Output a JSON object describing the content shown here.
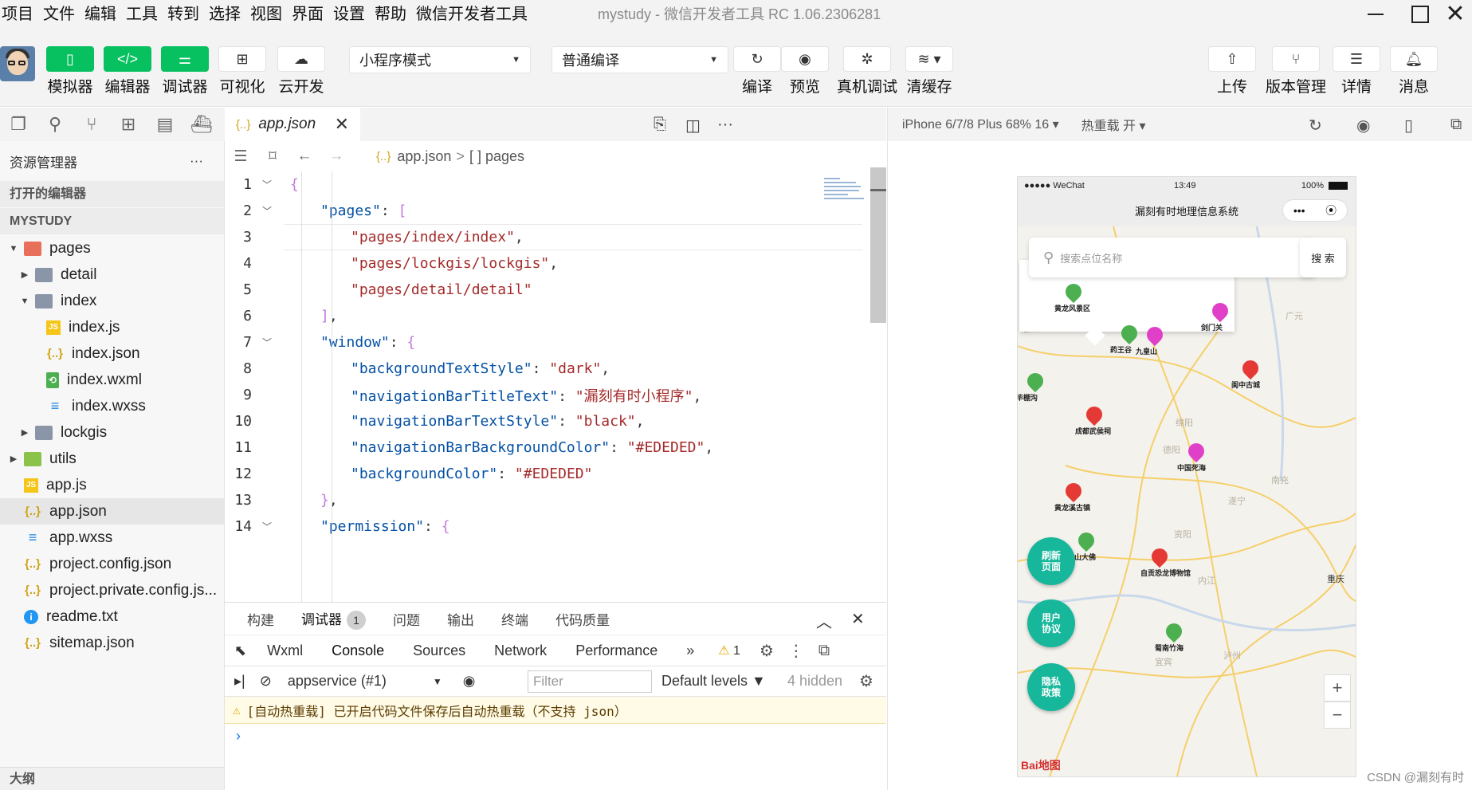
{
  "menu": [
    "项目",
    "文件",
    "编辑",
    "工具",
    "转到",
    "选择",
    "视图",
    "界面",
    "设置",
    "帮助",
    "微信开发者工具"
  ],
  "window_title": "mystudy - 微信开发者工具 RC 1.06.2306281",
  "toolbar": {
    "simulator": "模拟器",
    "editor": "编辑器",
    "debugger": "调试器",
    "visual": "可视化",
    "cloud": "云开发",
    "mode": "小程序模式",
    "compile_mode": "普通编译",
    "compile": "编译",
    "preview": "预览",
    "remote_debug": "真机调试",
    "clear_cache": "清缓存",
    "upload": "上传",
    "version": "版本管理",
    "details": "详情",
    "messages": "消息"
  },
  "explorer": {
    "title": "资源管理器",
    "more": "···",
    "open_editors": "打开的编辑器",
    "project": "MYSTUDY",
    "tree": [
      {
        "label": "pages",
        "depth": 0,
        "type": "folder-pages",
        "twisty": "▼"
      },
      {
        "label": "detail",
        "depth": 1,
        "type": "folder",
        "twisty": "▶"
      },
      {
        "label": "index",
        "depth": 1,
        "type": "folder",
        "twisty": "▼"
      },
      {
        "label": "index.js",
        "depth": 2,
        "type": "js",
        "twisty": ""
      },
      {
        "label": "index.json",
        "depth": 2,
        "type": "json",
        "twisty": ""
      },
      {
        "label": "index.wxml",
        "depth": 2,
        "type": "wxml",
        "twisty": ""
      },
      {
        "label": "index.wxss",
        "depth": 2,
        "type": "wxss",
        "twisty": ""
      },
      {
        "label": "lockgis",
        "depth": 1,
        "type": "folder",
        "twisty": "▶"
      },
      {
        "label": "utils",
        "depth": 0,
        "type": "folder-utils",
        "twisty": "▶"
      },
      {
        "label": "app.js",
        "depth": 0,
        "type": "js",
        "twisty": ""
      },
      {
        "label": "app.json",
        "depth": 0,
        "type": "json",
        "twisty": "",
        "selected": true
      },
      {
        "label": "app.wxss",
        "depth": 0,
        "type": "wxss",
        "twisty": ""
      },
      {
        "label": "project.config.json",
        "depth": 0,
        "type": "json",
        "twisty": ""
      },
      {
        "label": "project.private.config.js...",
        "depth": 0,
        "type": "json",
        "twisty": ""
      },
      {
        "label": "readme.txt",
        "depth": 0,
        "type": "txt",
        "twisty": ""
      },
      {
        "label": "sitemap.json",
        "depth": 0,
        "type": "json",
        "twisty": ""
      }
    ],
    "outline": "大纲"
  },
  "editor": {
    "tab": "app.json",
    "breadcrumb_file": "app.json",
    "breadcrumb_sep": ">",
    "breadcrumb_node": "[ ] pages",
    "lines": [
      {
        "n": "1",
        "fold": true,
        "indent": 0,
        "parts": [
          [
            "p",
            "{"
          ]
        ]
      },
      {
        "n": "2",
        "fold": true,
        "indent": 1,
        "parts": [
          [
            "key",
            "\"pages\""
          ],
          [
            "k",
            ": "
          ],
          [
            "p",
            "["
          ]
        ]
      },
      {
        "n": "3",
        "fold": false,
        "indent": 2,
        "current": true,
        "parts": [
          [
            "s",
            "\"pages/index/index\""
          ],
          [
            "k",
            ","
          ]
        ]
      },
      {
        "n": "4",
        "fold": false,
        "indent": 2,
        "parts": [
          [
            "s",
            "\"pages/lockgis/lockgis\""
          ],
          [
            "k",
            ","
          ]
        ]
      },
      {
        "n": "5",
        "fold": false,
        "indent": 2,
        "parts": [
          [
            "s",
            "\"pages/detail/detail\""
          ]
        ]
      },
      {
        "n": "6",
        "fold": false,
        "indent": 1,
        "parts": [
          [
            "p",
            "]"
          ],
          [
            "k",
            ","
          ]
        ]
      },
      {
        "n": "7",
        "fold": true,
        "indent": 1,
        "parts": [
          [
            "key",
            "\"window\""
          ],
          [
            "k",
            ": "
          ],
          [
            "p",
            "{"
          ]
        ]
      },
      {
        "n": "8",
        "fold": false,
        "indent": 2,
        "parts": [
          [
            "key",
            "\"backgroundTextStyle\""
          ],
          [
            "k",
            ": "
          ],
          [
            "s",
            "\"dark\""
          ],
          [
            "k",
            ","
          ]
        ]
      },
      {
        "n": "9",
        "fold": false,
        "indent": 2,
        "parts": [
          [
            "key",
            "\"navigationBarTitleText\""
          ],
          [
            "k",
            ": "
          ],
          [
            "s",
            "\"漏刻有时小程序\""
          ],
          [
            "k",
            ","
          ]
        ]
      },
      {
        "n": "10",
        "fold": false,
        "indent": 2,
        "parts": [
          [
            "key",
            "\"navigationBarTextStyle\""
          ],
          [
            "k",
            ": "
          ],
          [
            "s",
            "\"black\""
          ],
          [
            "k",
            ","
          ]
        ]
      },
      {
        "n": "11",
        "fold": false,
        "indent": 2,
        "parts": [
          [
            "key",
            "\"navigationBarBackgroundColor\""
          ],
          [
            "k",
            ": "
          ],
          [
            "s",
            "\"#EDEDED\""
          ],
          [
            "k",
            ","
          ]
        ]
      },
      {
        "n": "12",
        "fold": false,
        "indent": 2,
        "parts": [
          [
            "key",
            "\"backgroundColor\""
          ],
          [
            "k",
            ": "
          ],
          [
            "s",
            "\"#EDEDED\""
          ]
        ]
      },
      {
        "n": "13",
        "fold": false,
        "indent": 1,
        "parts": [
          [
            "p",
            "}"
          ],
          [
            "k",
            ","
          ]
        ]
      },
      {
        "n": "14",
        "fold": true,
        "indent": 1,
        "parts": [
          [
            "key",
            "\"permission\""
          ],
          [
            "k",
            ": "
          ],
          [
            "p",
            "{"
          ]
        ]
      }
    ]
  },
  "panel": {
    "tabs": [
      "构建",
      "调试器",
      "问题",
      "输出",
      "终端",
      "代码质量"
    ],
    "active_tab": "调试器",
    "badge": "1",
    "devtabs": [
      "Wxml",
      "Console",
      "Sources",
      "Network",
      "Performance"
    ],
    "active_devtab": "Console",
    "more_tabs": "»",
    "warn_count": "1",
    "context": "appservice (#1)",
    "filter_placeholder": "Filter",
    "levels": "Default levels ▼",
    "hidden": "4 hidden",
    "warning_message": "[自动热重载] 已开启代码文件保存后自动热重载（不支持 json）",
    "prompt": "›"
  },
  "simulator": {
    "device": "iPhone 6/7/8 Plus 68% 16 ▾",
    "hot_reload": "热重载 开 ▾",
    "status_carrier": "●●●●● WeChat",
    "status_time": "13:49",
    "status_battery": "100%",
    "nav_title": "漏刻有时地理信息系统",
    "capsule_more": "•••",
    "capsule_close": "⦿",
    "search_placeholder": "搜索点位名称",
    "search_button": "搜 索",
    "buttons": [
      "刷新页面",
      "用户协议",
      "隐私政策"
    ],
    "zoom_in": "+",
    "zoom_out": "−",
    "map_logo": "Bai地图",
    "pins": [
      {
        "label": "黄龙风景区",
        "color": "#4caf50"
      },
      {
        "label": "剑门关",
        "color": "#e040c8"
      },
      {
        "label": "药王谷",
        "color": "#4caf50"
      },
      {
        "label": "九皇山",
        "color": "#e040c8"
      },
      {
        "label": "阆中古城",
        "color": "#e53935"
      },
      {
        "label": "毕棚沟",
        "color": "#4caf50"
      },
      {
        "label": "中国死海",
        "color": "#e040c8"
      },
      {
        "label": "东山大佛",
        "color": "#4caf50"
      },
      {
        "label": "自贡恐龙博物馆",
        "color": "#e53935"
      },
      {
        "label": "蜀南竹海",
        "color": "#4caf50"
      },
      {
        "label": "黄龙溪古镇",
        "color": "#e53935"
      },
      {
        "label": "成都武侯祠",
        "color": "#e53935"
      }
    ]
  },
  "watermark": "CSDN @漏刻有时"
}
